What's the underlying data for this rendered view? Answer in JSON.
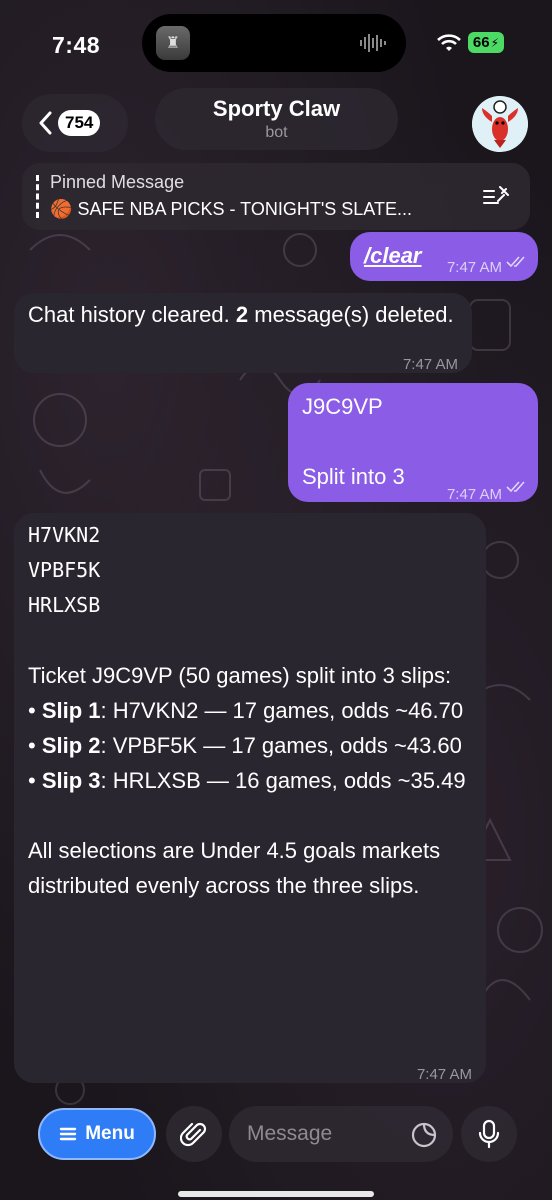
{
  "status_bar": {
    "time": "7:48",
    "battery": "66"
  },
  "header": {
    "back_count": "754",
    "title": "Sporty Claw",
    "subtitle": "bot",
    "avatar_icon": "lobster-icon"
  },
  "pinned": {
    "title": "Pinned Message",
    "emoji": "🏀",
    "text": "SAFE NBA PICKS - TONIGHT'S SLATE..."
  },
  "messages": [
    {
      "side": "out",
      "text": "/clear",
      "time": "7:47 AM",
      "status": "read"
    },
    {
      "side": "in",
      "text_before": "Chat history cleared. ",
      "bold": "2",
      "text_after": " message(s) deleted.",
      "time": "7:47 AM"
    },
    {
      "side": "out",
      "line1": "J9C9VP",
      "line2": "Split into 3",
      "time": "7:47 AM",
      "status": "read"
    },
    {
      "side": "in",
      "codes": [
        "H7VKN2",
        "VPBF5K",
        "HRLXSB"
      ],
      "intro": "Ticket J9C9VP (50 games) split into 3 slips:",
      "slips": [
        {
          "label": "Slip 1",
          "text": ": H7VKN2 — 17 games, odds ~46.70"
        },
        {
          "label": "Slip 2",
          "text": ": VPBF5K — 17 games, odds ~43.60"
        },
        {
          "label": "Slip 3",
          "text": ": HRLXSB — 16 games, odds ~35.49"
        }
      ],
      "footer": "All selections are Under 4.5 goals markets distributed evenly across the three slips.",
      "time": "7:47 AM"
    }
  ],
  "composer": {
    "menu_label": "Menu",
    "placeholder": "Message"
  }
}
